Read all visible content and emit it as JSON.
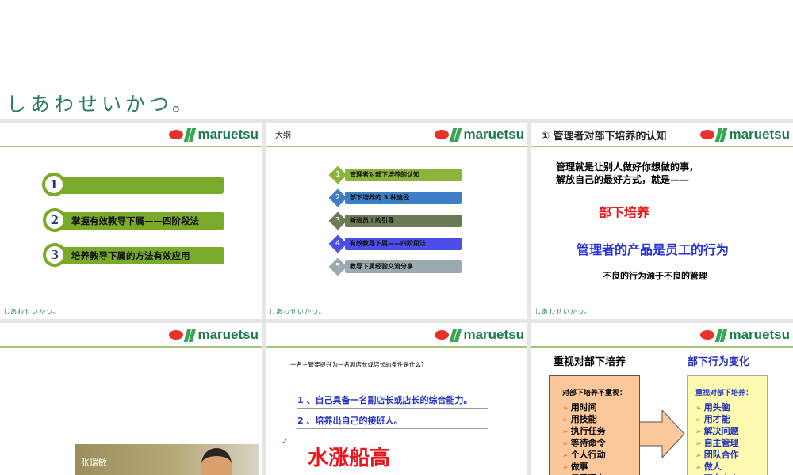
{
  "tagline": "しあわせいかつ。",
  "logo_text": "maruetsu",
  "footer_tagline": "しあわせいかつ。",
  "slide1": {
    "items": [
      {
        "num": "1",
        "label": ""
      },
      {
        "num": "2",
        "label": "掌握有效教导下属——四阶段法"
      },
      {
        "num": "3",
        "label": "培养教导下属的方法有效应用"
      }
    ]
  },
  "slide2": {
    "title": "大纲",
    "items": [
      {
        "num": "1",
        "label": "管理者对部下培养的认知",
        "color": "#8cb33a"
      },
      {
        "num": "2",
        "label": "部下培养的 3 种途径",
        "color": "#3d7fc6"
      },
      {
        "num": "3",
        "label": "新进员工的引导",
        "color": "#6b7a55"
      },
      {
        "num": "4",
        "label": "有效教导下属——四阶段法",
        "color": "#4b4fe8"
      },
      {
        "num": "5",
        "label": "教导下属经验交流分享",
        "color": "#9aabb0"
      }
    ]
  },
  "slide3": {
    "title": "① 管理者对部下培养的认知",
    "line1": "管理就是让别人做好你想做的事，",
    "line2": "解放自己的最好方式，就是——",
    "red": "部下培养",
    "blue": "管理者的产品是员工的行为",
    "note": "不良的行为源于不良的管理"
  },
  "slide4": {
    "photo_name": "张瑞敏"
  },
  "slide5": {
    "question": "一名主管要提升为一名副店长或店长的条件是什么？",
    "a1": "1 、自己具备一名副店长或店长的综合能力。",
    "a2": "2 、培养出自己的接班人。",
    "check": "✓",
    "big": "水涨船高"
  },
  "slide6": {
    "left_title": "重视对部下培养",
    "right_title": "部下行为变化",
    "left_head": "对部下培养不重视：",
    "left_items": [
      "用时间",
      "用技能",
      "执行任务",
      "等待命令",
      "个人行动",
      "做事",
      "只看现在"
    ],
    "right_head": "重视对部下培养：",
    "right_items": [
      "用头脑",
      "用才能",
      "解决问题",
      "自主管理",
      "团队合作",
      "做人",
      "面向未来"
    ]
  }
}
